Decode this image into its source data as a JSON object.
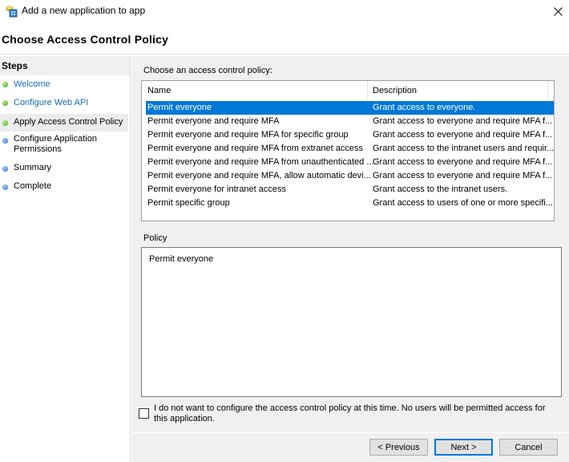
{
  "window": {
    "title": "Add a new application to app",
    "icon": "application-icon",
    "close_icon": "close-icon"
  },
  "header": {
    "title": "Choose Access Control Policy"
  },
  "sidebar": {
    "heading": "Steps",
    "items": [
      {
        "label": "Welcome",
        "status": "done",
        "link": true
      },
      {
        "label": "Configure Web API",
        "status": "done",
        "link": true
      },
      {
        "label": "Apply Access Control Policy",
        "status": "current",
        "link": false
      },
      {
        "label": "Configure Application Permissions",
        "status": "pending",
        "link": false
      },
      {
        "label": "Summary",
        "status": "pending",
        "link": false
      },
      {
        "label": "Complete",
        "status": "pending",
        "link": false
      }
    ]
  },
  "main": {
    "choose_label": "Choose an access control policy:",
    "columns": [
      "Name",
      "Description"
    ],
    "rows": [
      {
        "name": "Permit everyone",
        "description": "Grant access to everyone.",
        "selected": true
      },
      {
        "name": "Permit everyone and require MFA",
        "description": "Grant access to everyone and require MFA f..."
      },
      {
        "name": "Permit everyone and require MFA for specific group",
        "description": "Grant access to everyone and require MFA f..."
      },
      {
        "name": "Permit everyone and require MFA from extranet access",
        "description": "Grant access to the intranet users and requir..."
      },
      {
        "name": "Permit everyone and require MFA from unauthenticated ...",
        "description": "Grant access to everyone and require MFA f..."
      },
      {
        "name": "Permit everyone and require MFA, allow automatic devi...",
        "description": "Grant access to everyone and require MFA f..."
      },
      {
        "name": "Permit everyone for intranet access",
        "description": "Grant access to the intranet users."
      },
      {
        "name": "Permit specific group",
        "description": "Grant access to users of one or more specifi..."
      }
    ],
    "policy_label": "Policy",
    "policy_text": "Permit everyone",
    "skip_checkbox": {
      "checked": false,
      "label": "I do not want to configure the access control policy at this time.  No users will be permitted access for this application."
    }
  },
  "buttons": {
    "previous": "< Previous",
    "next": "Next >",
    "cancel": "Cancel"
  },
  "colors": {
    "selection": "#0078d7",
    "link": "#1c6bb5",
    "step_done": "#39a51a",
    "step_pending": "#2a6fd6"
  }
}
